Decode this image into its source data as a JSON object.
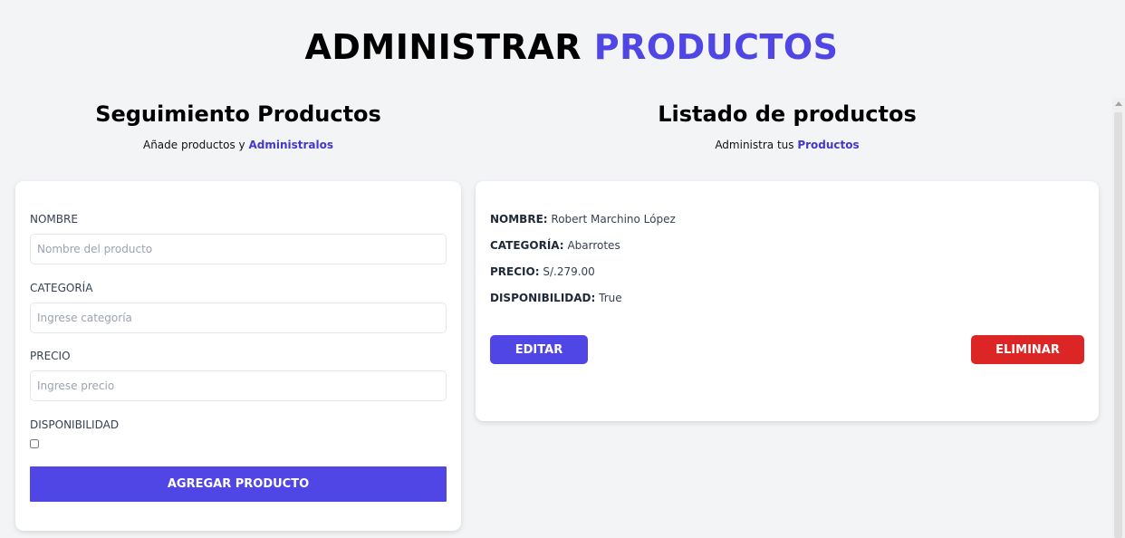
{
  "page": {
    "title_part1": "ADMINISTRAR",
    "title_part2": "PRODUCTOS",
    "accent_color": "#4f46e5",
    "danger_color": "#dc2626"
  },
  "form_section": {
    "heading": "Seguimiento Productos",
    "subtitle_text": "Añade productos y",
    "subtitle_accent": "Administralos",
    "fields": [
      {
        "label": "Nombre",
        "placeholder": "Nombre del producto",
        "value": ""
      },
      {
        "label": "Categoría",
        "placeholder": "Ingrese categoría",
        "value": ""
      },
      {
        "label": "Precio",
        "placeholder": "Ingrese precio",
        "value": ""
      }
    ],
    "availability_label": "Disponibilidad",
    "availability_checked": false,
    "submit_label": "Agregar Producto"
  },
  "list_section": {
    "heading": "Listado de productos",
    "subtitle_text": "Administra tus",
    "subtitle_accent": "Productos",
    "products": [
      {
        "name_key": "NOMBRE:",
        "name": "Robert Marchino López",
        "category_key": "CATEGORÍA:",
        "category": "Abarrotes",
        "price_key": "PRECIO:",
        "price": "S/.279.00",
        "availability_key": "DISPONIBILIDAD:",
        "availability": "True",
        "edit_label": "Editar",
        "delete_label": "Eliminar"
      }
    ]
  }
}
